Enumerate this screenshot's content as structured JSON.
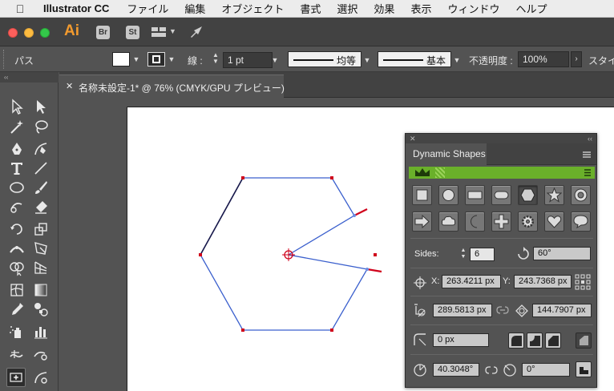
{
  "menubar": {
    "app_name": "Illustrator CC",
    "items": [
      "ファイル",
      "編集",
      "オブジェクト",
      "書式",
      "選択",
      "効果",
      "表示",
      "ウィンドウ",
      "ヘルプ"
    ]
  },
  "appbar": {
    "logo": "Ai",
    "bridge": "Br",
    "stock": "St"
  },
  "control_bar": {
    "selection_type": "パス",
    "stroke_label": "線 :",
    "stroke_weight": "1 pt",
    "profile_uniform": "均等",
    "brush_basic": "基本",
    "opacity_label": "不透明度 :",
    "opacity_value": "100%",
    "style_label": "スタイ"
  },
  "document": {
    "tab_title": "名称未設定-1* @ 76% (CMYK/GPU プレビュー)"
  },
  "panel": {
    "title": "Dynamic Shapes",
    "sides_label": "Sides:",
    "sides_value": "6",
    "rotation_value": "60°",
    "x_label": "X:",
    "x_value": "263.4211 px",
    "y_label": "Y:",
    "y_value": "243.7368 px",
    "width_value": "289.5813 px",
    "height_value": "144.7907 px",
    "corner_value": "0 px",
    "angle_value": "40.3048°",
    "angle2_value": "0°"
  },
  "colors": {
    "menubar_bg": "#ececec",
    "ui_bg": "#535353",
    "app_bar_bg": "#424242",
    "panel_green": "#6ab02a",
    "selection_blue": "#3a5fcd",
    "anchor_red": "#d0021b"
  }
}
